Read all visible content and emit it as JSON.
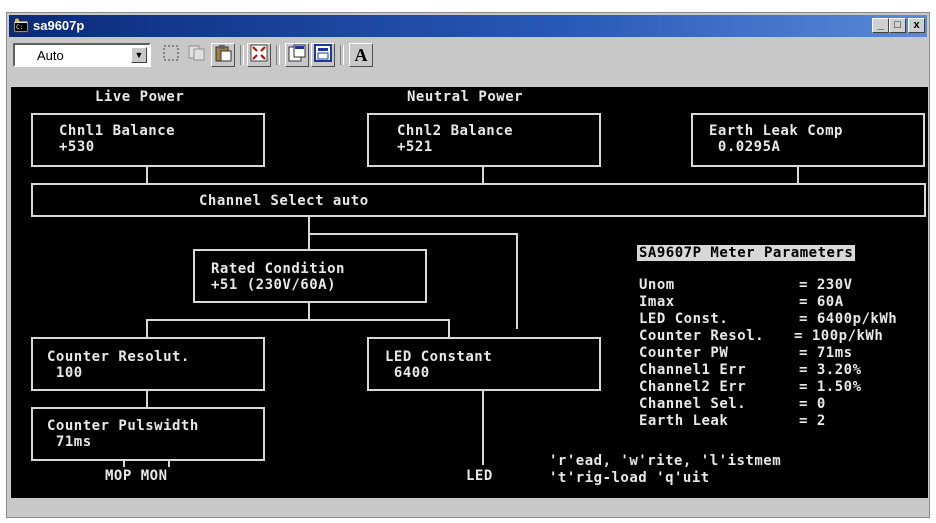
{
  "window": {
    "title": "sa9607p",
    "controls": {
      "minimize": "_",
      "maximize": "□",
      "close": "x"
    }
  },
  "toolbar": {
    "font_select_value": "Auto",
    "buttons": [
      {
        "name": "mark-icon"
      },
      {
        "name": "copy-icon"
      },
      {
        "name": "paste-icon"
      },
      {
        "name": "fullscreen-icon"
      },
      {
        "name": "properties-icon"
      },
      {
        "name": "background-icon"
      },
      {
        "name": "font-icon",
        "label": "A"
      }
    ]
  },
  "console": {
    "headings": {
      "live": "Live Power",
      "neutral": "Neutral Power"
    },
    "boxes": {
      "chnl1": {
        "line1": "Chnl1 Balance",
        "line2": "+530"
      },
      "chnl2": {
        "line1": "Chnl2 Balance",
        "line2": "+521"
      },
      "earth": {
        "line1": "Earth Leak Comp",
        "line2": " 0.0295A"
      },
      "channel_select": "Channel Select auto",
      "rated": {
        "line1": "Rated Condition",
        "line2": "+51 (230V/60A)"
      },
      "counter_resol": {
        "line1": "Counter Resolut.",
        "line2": " 100"
      },
      "led_constant": {
        "line1": "LED Constant",
        "line2": " 6400"
      },
      "counter_pulse": {
        "line1": "Counter Pulswidth",
        "line2": " 71ms"
      }
    },
    "bottom_labels": {
      "mop_mon": "MOP MON",
      "led": "LED"
    },
    "params": {
      "title": "SA9607P Meter Parameters",
      "rows": [
        {
          "name": "Unom",
          "value": "= 230V"
        },
        {
          "name": "Imax",
          "value": "= 60A"
        },
        {
          "name": "LED Const.",
          "value": "= 6400p/kWh"
        },
        {
          "name": "Counter Resol.",
          "value": "= 100p/kWh"
        },
        {
          "name": "Counter PW",
          "value": "= 71ms"
        },
        {
          "name": "Channel1 Err",
          "value": "= 3.20%"
        },
        {
          "name": "Channel2 Err",
          "value": "= 1.50%"
        },
        {
          "name": "Channel Sel.",
          "value": "= 0"
        },
        {
          "name": "Earth Leak",
          "value": "= 2"
        }
      ]
    },
    "help": {
      "line1": "'r'ead, 'w'rite, 'l'istmem",
      "line2": "'t'rig-load 'q'uit"
    }
  }
}
